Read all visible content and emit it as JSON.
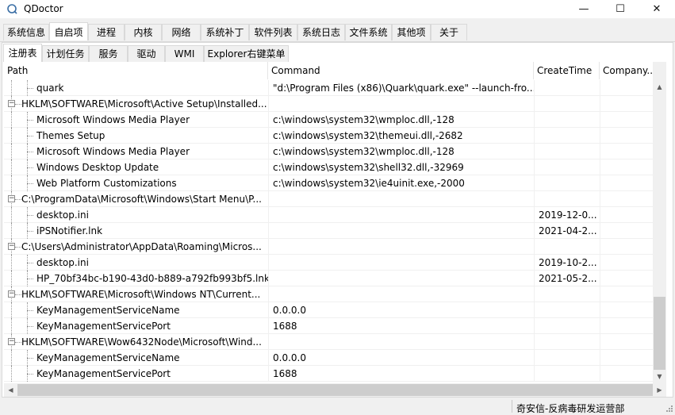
{
  "window": {
    "title": "QDoctor",
    "minimize": "—",
    "maximize": "☐",
    "close": "✕"
  },
  "main_tabs": [
    "系统信息",
    "自启项",
    "进程",
    "内核",
    "网络",
    "系统补丁",
    "软件列表",
    "系统日志",
    "文件系统",
    "其他项",
    "关于"
  ],
  "main_tab_active": "自启项",
  "sub_tabs": [
    "注册表",
    "计划任务",
    "服务",
    "驱动",
    "WMI",
    "Explorer右键菜单"
  ],
  "sub_tab_active": "注册表",
  "columns": [
    "Path",
    "Command",
    "CreateTime",
    "Company..."
  ],
  "rows": [
    {
      "level": 1,
      "path": "quark",
      "command": "\"d:\\Program Files (x86)\\Quark\\quark.exe\" --launch-fro...",
      "time": "",
      "company": ""
    },
    {
      "level": 0,
      "path": "HKLM\\SOFTWARE\\Microsoft\\Active Setup\\Installed...",
      "command": "",
      "time": "",
      "company": ""
    },
    {
      "level": 1,
      "path": "Microsoft Windows Media Player",
      "command": "c:\\windows\\system32\\wmploc.dll,-128",
      "time": "",
      "company": ""
    },
    {
      "level": 1,
      "path": "Themes Setup",
      "command": "c:\\windows\\system32\\themeui.dll,-2682",
      "time": "",
      "company": ""
    },
    {
      "level": 1,
      "path": "Microsoft Windows Media Player",
      "command": "c:\\windows\\system32\\wmploc.dll,-128",
      "time": "",
      "company": ""
    },
    {
      "level": 1,
      "path": "Windows Desktop Update",
      "command": "c:\\windows\\system32\\shell32.dll,-32969",
      "time": "",
      "company": ""
    },
    {
      "level": 1,
      "path": "Web Platform Customizations",
      "command": "c:\\windows\\system32\\ie4uinit.exe,-2000",
      "time": "",
      "company": ""
    },
    {
      "level": 0,
      "path": "C:\\ProgramData\\Microsoft\\Windows\\Start Menu\\P...",
      "command": "",
      "time": "",
      "company": ""
    },
    {
      "level": 1,
      "path": "desktop.ini",
      "command": "",
      "time": "2019-12-0...",
      "company": ""
    },
    {
      "level": 1,
      "path": "iPSNotifier.lnk",
      "command": "",
      "time": "2021-04-2...",
      "company": ""
    },
    {
      "level": 0,
      "path": "C:\\Users\\Administrator\\AppData\\Roaming\\Micros...",
      "command": "",
      "time": "",
      "company": ""
    },
    {
      "level": 1,
      "path": "desktop.ini",
      "command": "",
      "time": "2019-10-2...",
      "company": ""
    },
    {
      "level": 1,
      "path": "HP_70bf34bc-b190-43d0-b889-a792fb993bf5.lnk",
      "command": "",
      "time": "2021-05-2...",
      "company": ""
    },
    {
      "level": 0,
      "path": "HKLM\\SOFTWARE\\Microsoft\\Windows NT\\Current...",
      "command": "",
      "time": "",
      "company": ""
    },
    {
      "level": 1,
      "path": "KeyManagementServiceName",
      "command": "0.0.0.0",
      "time": "",
      "company": ""
    },
    {
      "level": 1,
      "path": "KeyManagementServicePort",
      "command": "1688",
      "time": "",
      "company": ""
    },
    {
      "level": 0,
      "path": "HKLM\\SOFTWARE\\Wow6432Node\\Microsoft\\Wind...",
      "command": "",
      "time": "",
      "company": ""
    },
    {
      "level": 1,
      "path": "KeyManagementServiceName",
      "command": "0.0.0.0",
      "time": "",
      "company": ""
    },
    {
      "level": 1,
      "path": "KeyManagementServicePort",
      "command": "1688",
      "time": "",
      "company": ""
    }
  ],
  "expander_symbol": "−",
  "scroll": {
    "up": "▲",
    "down": "▼",
    "left": "◀",
    "right": "▶"
  },
  "status": {
    "text": "奇安信-反病毒研发运营部"
  }
}
